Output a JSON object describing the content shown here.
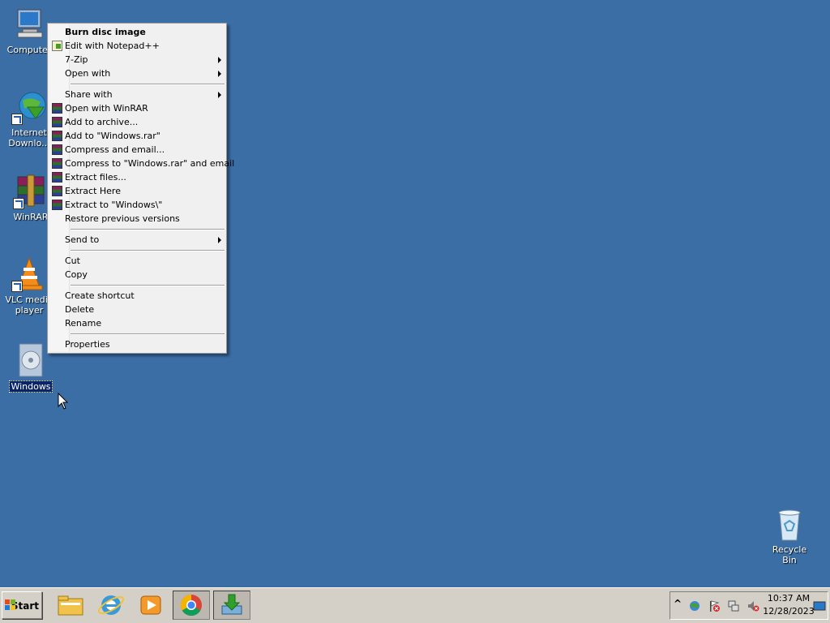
{
  "desktop": {
    "icons": [
      {
        "label": "Computer"
      },
      {
        "label": "Internet Downlo..."
      },
      {
        "label": "WinRAR"
      },
      {
        "label": "VLC media player"
      },
      {
        "label": "Windows"
      },
      {
        "label": "Recycle Bin"
      }
    ]
  },
  "context_menu": {
    "items": [
      {
        "label": "Burn disc image"
      },
      {
        "label": "Edit with Notepad++"
      },
      {
        "label": "7-Zip"
      },
      {
        "label": "Open with"
      },
      {
        "label": "Share with"
      },
      {
        "label": "Open with WinRAR"
      },
      {
        "label": "Add to archive..."
      },
      {
        "label": "Add to \"Windows.rar\""
      },
      {
        "label": "Compress and email..."
      },
      {
        "label": "Compress to \"Windows.rar\" and email"
      },
      {
        "label": "Extract files..."
      },
      {
        "label": "Extract Here"
      },
      {
        "label": "Extract to \"Windows\\\""
      },
      {
        "label": "Restore previous versions"
      },
      {
        "label": "Send to"
      },
      {
        "label": "Cut"
      },
      {
        "label": "Copy"
      },
      {
        "label": "Create shortcut"
      },
      {
        "label": "Delete"
      },
      {
        "label": "Rename"
      },
      {
        "label": "Properties"
      }
    ]
  },
  "taskbar": {
    "start_label": "Start",
    "pinned": [
      "file-explorer-icon",
      "internet-explorer-icon",
      "media-player-icon",
      "chrome-icon",
      "download-manager-icon"
    ],
    "clock_time": "10:37 AM",
    "clock_date": "12/28/2023"
  },
  "colors": {
    "desktop": "#3a6ea5",
    "menu_bg": "#f0f0f0",
    "taskbar": "#d4d0c8",
    "selection": "#0a246a"
  }
}
